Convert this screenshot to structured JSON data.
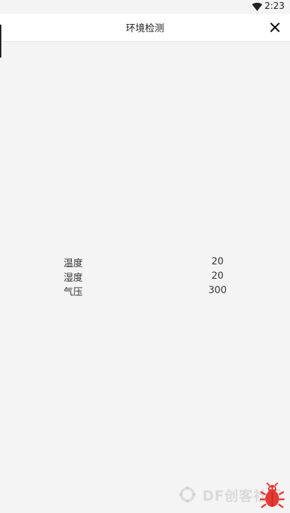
{
  "status_bar": {
    "time": "2:23",
    "icons": [
      "wifi-icon"
    ]
  },
  "header": {
    "title": "环境检测",
    "close_icon": "close-icon"
  },
  "readings": [
    {
      "label": "温度",
      "value": "20"
    },
    {
      "label": "湿度",
      "value": "20"
    },
    {
      "label": "气压",
      "value": "300"
    }
  ],
  "watermark": {
    "text": "DF创客社区"
  },
  "colors": {
    "background": "#f4f4f4",
    "header_bg": "#ffffff",
    "bug_logo": "#e53935"
  }
}
